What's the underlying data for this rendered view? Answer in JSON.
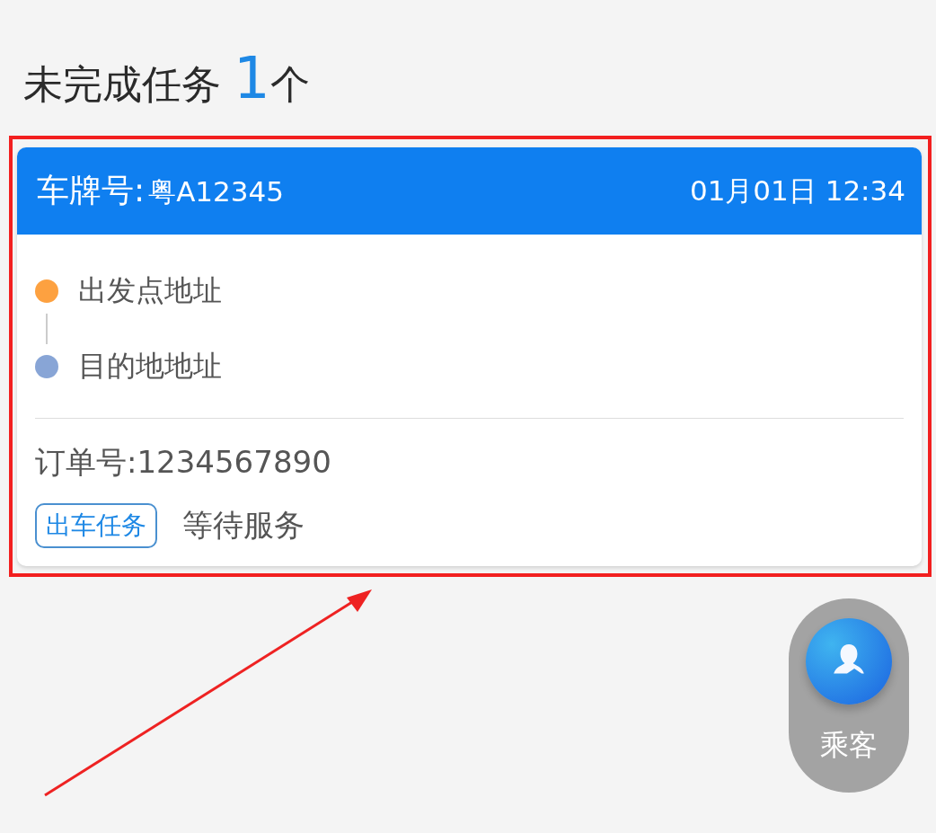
{
  "heading": {
    "title": "未完成任务",
    "count": "1",
    "unit": "个"
  },
  "task_card": {
    "plate_label": "车牌号:",
    "plate": "粤A12345",
    "datetime": "01月01日 12:34",
    "stops": [
      {
        "label": "出发点地址",
        "color": "#fda140"
      },
      {
        "label": "目的地地址",
        "color": "#88a5d6"
      }
    ],
    "order_number": "订单号:1234567890",
    "tag": "出车任务",
    "status": "等待服务"
  },
  "floating_button": {
    "label": "乘客"
  },
  "annotation": {
    "highlight_frame": true,
    "pointer_arrow": true
  }
}
